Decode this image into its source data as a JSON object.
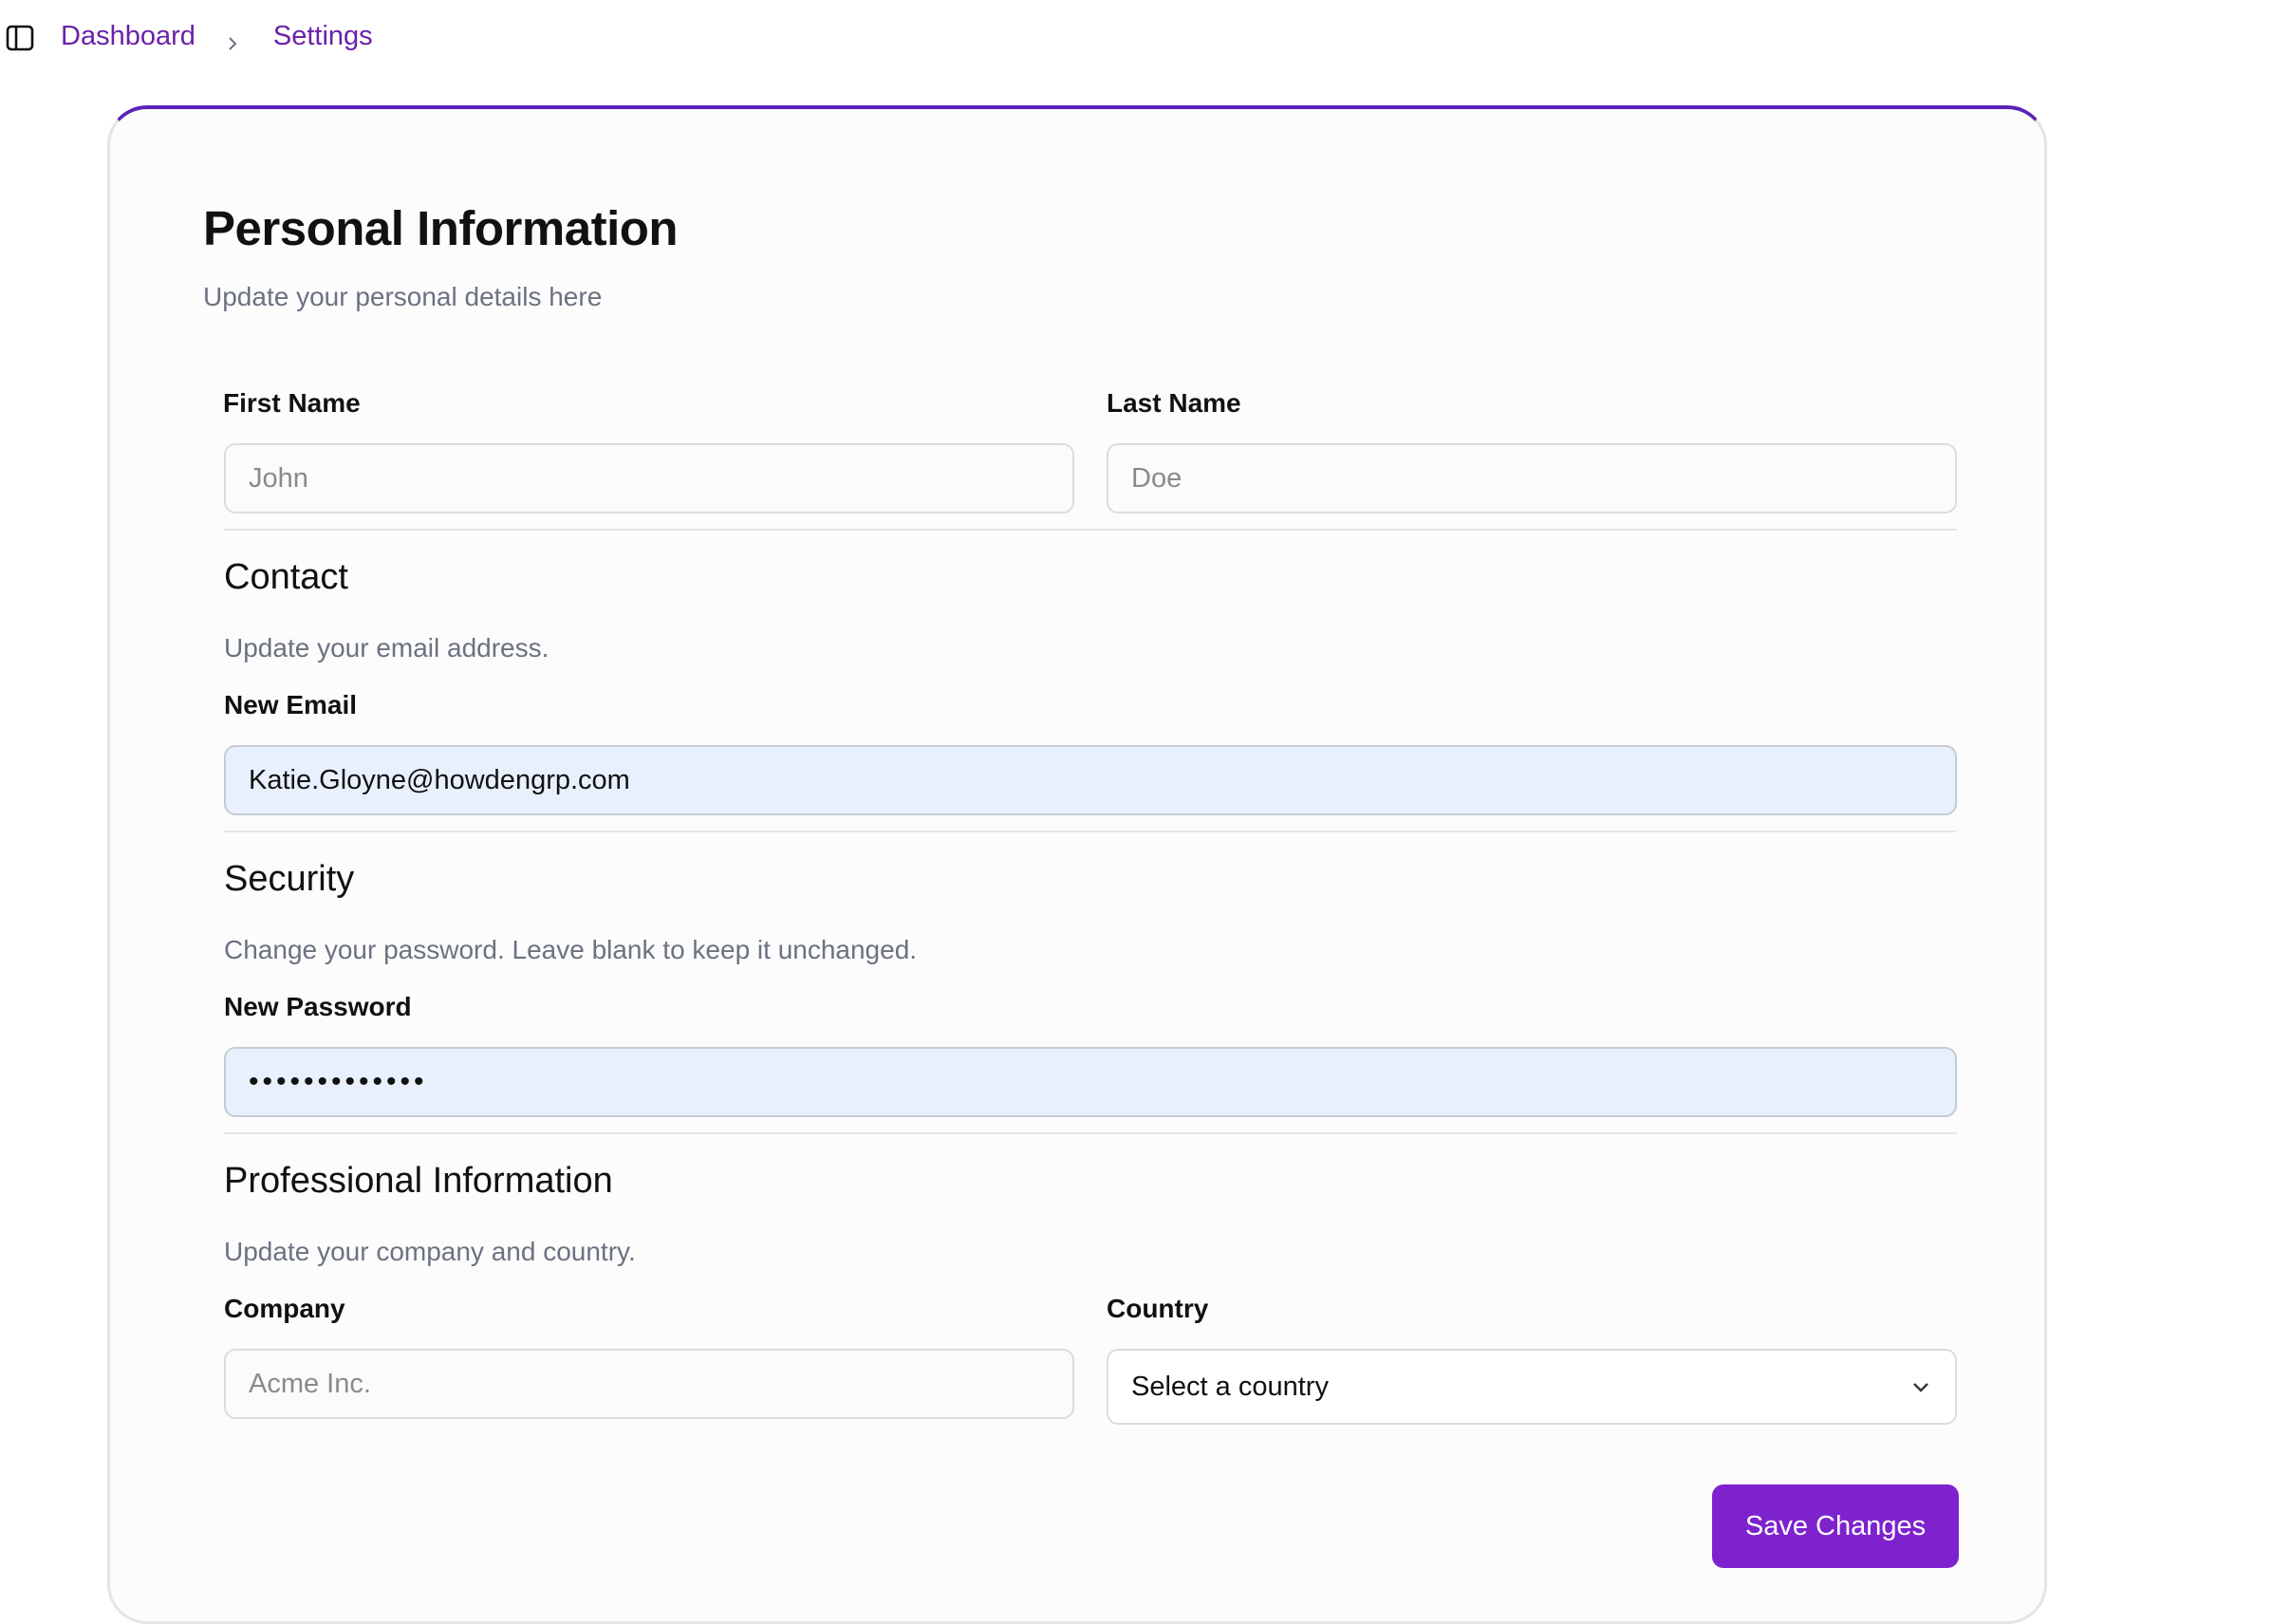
{
  "breadcrumb": {
    "items": [
      "Dashboard",
      "Settings"
    ]
  },
  "icons": {
    "sidebar_toggle": "sidebar-panel-icon",
    "separator": "chevron-right-icon",
    "select_arrow": "chevron-down-icon"
  },
  "colors": {
    "accent": "#7e22ce",
    "link": "#6b21a8",
    "card_top_border": "#5b21b6",
    "autofill_bg": "#e8f0fe"
  },
  "card": {
    "title": "Personal Information",
    "subtitle": "Update your personal details here"
  },
  "name_section": {
    "first_name": {
      "label": "First Name",
      "placeholder": "John",
      "value": ""
    },
    "last_name": {
      "label": "Last Name",
      "placeholder": "Doe",
      "value": ""
    }
  },
  "contact": {
    "title": "Contact",
    "description": "Update your email address.",
    "email": {
      "label": "New Email",
      "value": "Katie.Gloyne@howdengrp.com"
    }
  },
  "security": {
    "title": "Security",
    "description": "Change your password. Leave blank to keep it unchanged.",
    "password": {
      "label": "New Password",
      "value": "•••••••••••••"
    }
  },
  "professional": {
    "title": "Professional Information",
    "description": "Update your company and country.",
    "company": {
      "label": "Company",
      "placeholder": "Acme Inc.",
      "value": ""
    },
    "country": {
      "label": "Country",
      "selected": "Select a country"
    }
  },
  "actions": {
    "save_label": "Save Changes"
  }
}
